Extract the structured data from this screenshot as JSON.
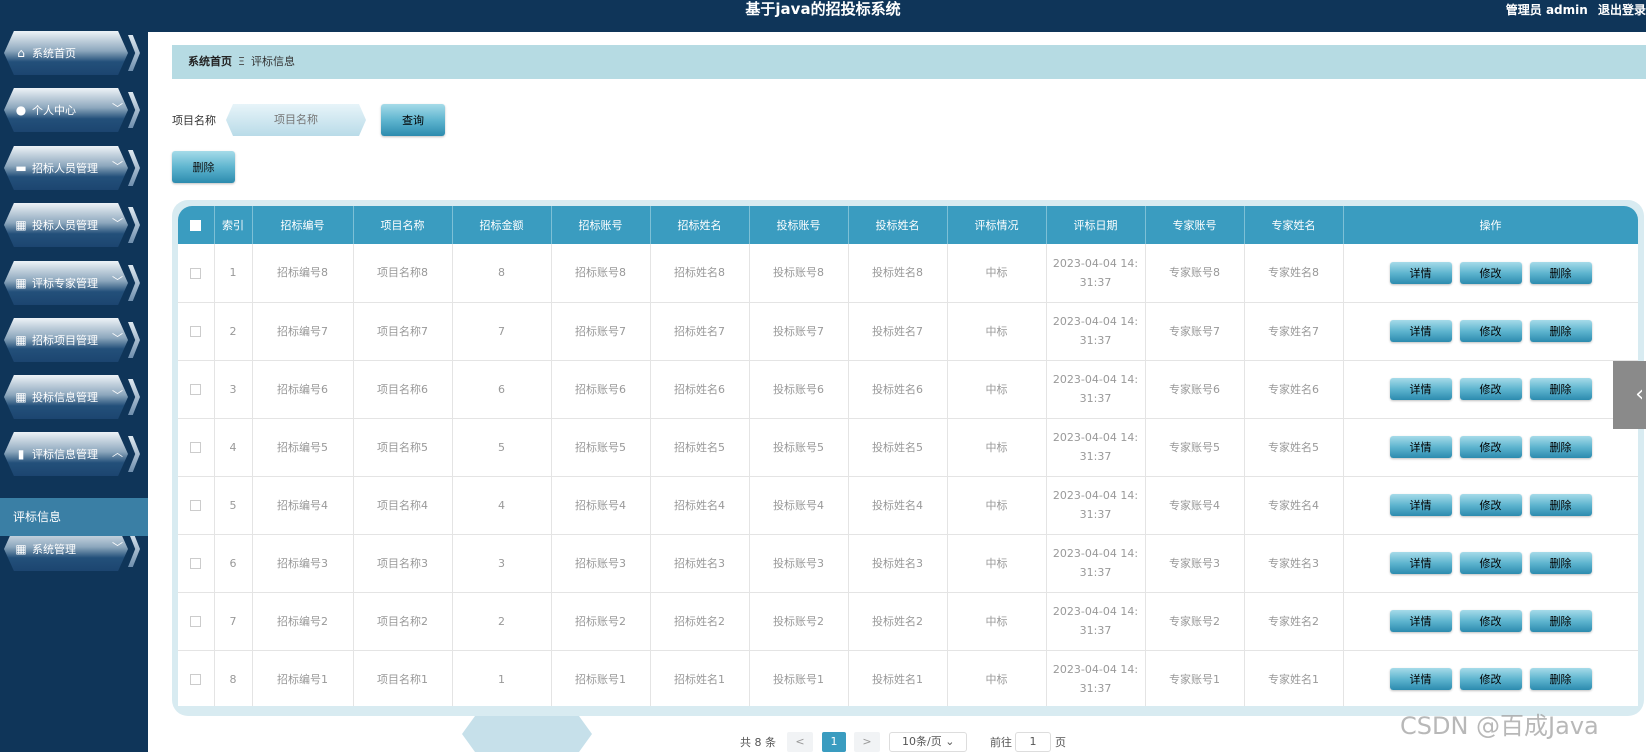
{
  "header": {
    "title": "基于java的招投标系统",
    "user": "管理员 admin",
    "logout": "退出登录"
  },
  "sidebar": {
    "items": [
      {
        "label": "系统首页",
        "icon": "home-icon",
        "chevron": ""
      },
      {
        "label": "个人中心",
        "icon": "user-icon",
        "chevron": "﹀"
      },
      {
        "label": "招标人员管理",
        "icon": "monitor-icon",
        "chevron": "﹀"
      },
      {
        "label": "投标人员管理",
        "icon": "grid-icon",
        "chevron": "﹀"
      },
      {
        "label": "评标专家管理",
        "icon": "grid-icon",
        "chevron": "﹀"
      },
      {
        "label": "招标项目管理",
        "icon": "grid-icon",
        "chevron": "﹀"
      },
      {
        "label": "投标信息管理",
        "icon": "grid-icon",
        "chevron": "﹀"
      },
      {
        "label": "评标信息管理",
        "icon": "bar-chart-icon",
        "chevron": "︿"
      },
      {
        "label": "系统管理",
        "icon": "grid-icon",
        "chevron": "﹀"
      }
    ],
    "submenu_active": "评标信息"
  },
  "breadcrumb": {
    "home": "系统首页",
    "separator": "Ξ",
    "current": "评标信息"
  },
  "search": {
    "label": "项目名称",
    "placeholder": "项目名称",
    "query_button": "查询"
  },
  "toolbar": {
    "delete_button": "删除"
  },
  "table": {
    "headers": [
      "索引",
      "招标编号",
      "项目名称",
      "招标金额",
      "招标账号",
      "招标姓名",
      "投标账号",
      "投标姓名",
      "评标情况",
      "评标日期",
      "专家账号",
      "专家姓名",
      "操作"
    ],
    "actions": [
      "详情",
      "修改",
      "删除"
    ],
    "rows": [
      {
        "index": "1",
        "bid_no": "招标编号8",
        "project": "项目名称8",
        "amount": "8",
        "tender_acct": "招标账号8",
        "tender_name": "招标姓名8",
        "bidder_acct": "投标账号8",
        "bidder_name": "投标姓名8",
        "result": "中标",
        "date1": "2023-04-04 14:",
        "date2": "31:37",
        "expert_acct": "专家账号8",
        "expert_name": "专家姓名8"
      },
      {
        "index": "2",
        "bid_no": "招标编号7",
        "project": "项目名称7",
        "amount": "7",
        "tender_acct": "招标账号7",
        "tender_name": "招标姓名7",
        "bidder_acct": "投标账号7",
        "bidder_name": "投标姓名7",
        "result": "中标",
        "date1": "2023-04-04 14:",
        "date2": "31:37",
        "expert_acct": "专家账号7",
        "expert_name": "专家姓名7"
      },
      {
        "index": "3",
        "bid_no": "招标编号6",
        "project": "项目名称6",
        "amount": "6",
        "tender_acct": "招标账号6",
        "tender_name": "招标姓名6",
        "bidder_acct": "投标账号6",
        "bidder_name": "投标姓名6",
        "result": "中标",
        "date1": "2023-04-04 14:",
        "date2": "31:37",
        "expert_acct": "专家账号6",
        "expert_name": "专家姓名6"
      },
      {
        "index": "4",
        "bid_no": "招标编号5",
        "project": "项目名称5",
        "amount": "5",
        "tender_acct": "招标账号5",
        "tender_name": "招标姓名5",
        "bidder_acct": "投标账号5",
        "bidder_name": "投标姓名5",
        "result": "中标",
        "date1": "2023-04-04 14:",
        "date2": "31:37",
        "expert_acct": "专家账号5",
        "expert_name": "专家姓名5"
      },
      {
        "index": "5",
        "bid_no": "招标编号4",
        "project": "项目名称4",
        "amount": "4",
        "tender_acct": "招标账号4",
        "tender_name": "招标姓名4",
        "bidder_acct": "投标账号4",
        "bidder_name": "投标姓名4",
        "result": "中标",
        "date1": "2023-04-04 14:",
        "date2": "31:37",
        "expert_acct": "专家账号4",
        "expert_name": "专家姓名4"
      },
      {
        "index": "6",
        "bid_no": "招标编号3",
        "project": "项目名称3",
        "amount": "3",
        "tender_acct": "招标账号3",
        "tender_name": "招标姓名3",
        "bidder_acct": "投标账号3",
        "bidder_name": "投标姓名3",
        "result": "中标",
        "date1": "2023-04-04 14:",
        "date2": "31:37",
        "expert_acct": "专家账号3",
        "expert_name": "专家姓名3"
      },
      {
        "index": "7",
        "bid_no": "招标编号2",
        "project": "项目名称2",
        "amount": "2",
        "tender_acct": "招标账号2",
        "tender_name": "招标姓名2",
        "bidder_acct": "投标账号2",
        "bidder_name": "投标姓名2",
        "result": "中标",
        "date1": "2023-04-04 14:",
        "date2": "31:37",
        "expert_acct": "专家账号2",
        "expert_name": "专家姓名2"
      },
      {
        "index": "8",
        "bid_no": "招标编号1",
        "project": "项目名称1",
        "amount": "1",
        "tender_acct": "招标账号1",
        "tender_name": "招标姓名1",
        "bidder_acct": "投标账号1",
        "bidder_name": "投标姓名1",
        "result": "中标",
        "date1": "2023-04-04 14:",
        "date2": "31:37",
        "expert_acct": "专家账号1",
        "expert_name": "专家姓名1"
      }
    ]
  },
  "pagination": {
    "total": "共 8 条",
    "prev": "<",
    "current": "1",
    "next": ">",
    "page_size": "10条/页",
    "goto_label": "前往",
    "goto_value": "1",
    "page_unit": "页"
  },
  "watermark": "CSDN @百成Java",
  "colors": {
    "header_bg": "#0f3559",
    "accent": "#3a9cc0",
    "breadcrumb_bg": "#b6dbe3",
    "active_submenu": "#3a7fa5"
  }
}
